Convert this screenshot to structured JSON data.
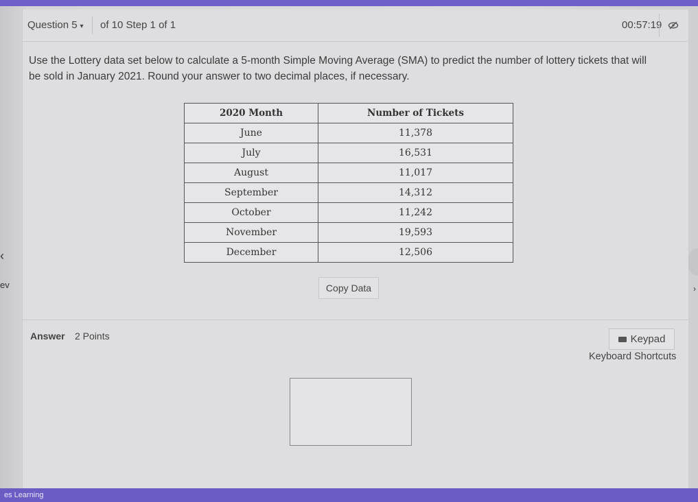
{
  "header": {
    "question_label": "Question 5",
    "step_label": "of 10 Step 1 of 1",
    "timer": "00:57:19"
  },
  "question": {
    "text": "Use the Lottery data set below to calculate a 5-month Simple Moving Average (SMA) to predict the number of lottery tickets that will be sold in January 2021. Round your answer to two decimal places, if necessary."
  },
  "table": {
    "headers": [
      "2020 Month",
      "Number of Tickets"
    ],
    "rows": [
      [
        "June",
        "11,378"
      ],
      [
        "July",
        "16,531"
      ],
      [
        "August",
        "11,017"
      ],
      [
        "September",
        "14,312"
      ],
      [
        "October",
        "11,242"
      ],
      [
        "November",
        "19,593"
      ],
      [
        "December",
        "12,506"
      ]
    ]
  },
  "copy_data_label": "Copy Data",
  "nav": {
    "prev_label": "ev"
  },
  "answer": {
    "label": "Answer",
    "points": "2 Points",
    "keypad_label": "Keypad",
    "shortcuts_label": "Keyboard Shortcuts",
    "value": ""
  },
  "footer": {
    "text": "es Learning"
  },
  "colors": {
    "accent": "#6e5fc9",
    "footer": "#6b5cc4",
    "panel": "#dedee0"
  }
}
